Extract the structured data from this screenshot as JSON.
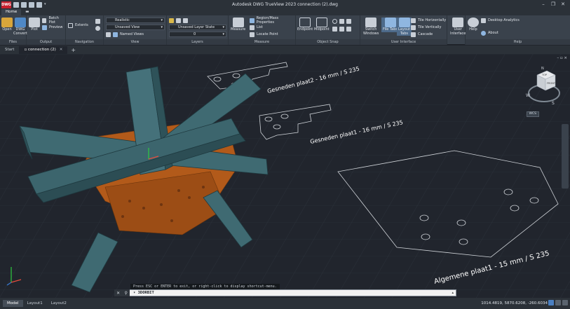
{
  "app": {
    "logo_text": "DWG",
    "title": "Autodesk DWG TrueView 2023   connection (2).dwg",
    "window_controls": [
      "–",
      "❐",
      "✕"
    ]
  },
  "ribbon_tabs": [
    {
      "label": "Home",
      "active": true
    },
    {
      "label": "▬",
      "active": false
    }
  ],
  "ribbon": {
    "files": {
      "label": "Files",
      "open": "Open",
      "dwg_convert": "DWG\nConvert"
    },
    "output": {
      "label": "Output",
      "plot": "Plot",
      "batch_plot": "Batch Plot",
      "preview": "Preview"
    },
    "navigation": {
      "label": "Navigation",
      "extents": "Extents"
    },
    "view": {
      "label": "View",
      "visual_style": "Realistic",
      "saved_view": "Unsaved View",
      "named_views": "Named Views"
    },
    "layers": {
      "label": "Layers",
      "layer_state": "Unsaved Layer State",
      "current_layer": "0"
    },
    "measure": {
      "label": "Measure",
      "measure": "Measure",
      "region_mass": "Region/Mass Properties",
      "list": "List",
      "locate_point": "Locate Point"
    },
    "object_snap": {
      "label": "Object Snap",
      "endpoint": "Endpoint",
      "midpoint": "Midpoint"
    },
    "user_interface": {
      "label": "User Interface",
      "switch_windows": "Switch\nWindows",
      "file_tabs": "File Tabs",
      "layout_tabs": "Layout\nTabs",
      "tile_h": "Tile Horizontally",
      "tile_v": "Tile Vertically",
      "cascade": "Cascade"
    },
    "help": {
      "label": "Help",
      "user_interface": "User\nInterface",
      "help": "Help",
      "desktop_analytics": "Desktop Analytics",
      "about": "About"
    }
  },
  "file_tabs": [
    {
      "label": "Start",
      "active": false,
      "closable": false
    },
    {
      "label": "connection (2)",
      "active": true,
      "closable": true
    }
  ],
  "viewport": {
    "controls": "– ▫ ×",
    "wcs": "WCS",
    "viewcube": {
      "top": "TOP",
      "front": "FRONT",
      "n": "N",
      "w": "W",
      "s": "S"
    }
  },
  "drawing_labels": [
    {
      "text": "Gesneden plaat2 - 16 mm / S 235"
    },
    {
      "text": "Gesneden plaat1 - 16 mm / S 235"
    },
    {
      "text": "Algemene plaat1 - 15 mm / S 235"
    }
  ],
  "command": {
    "history": "Press ESC or ENTER to exit, or right-click to display shortcut-menu.",
    "prompt": "3DORBIT",
    "prompt_prefix": "▾"
  },
  "status": {
    "layout_tabs": [
      {
        "label": "Model",
        "active": true
      },
      {
        "label": "Layout1",
        "active": false
      },
      {
        "label": "Layout2",
        "active": false
      }
    ],
    "coords": "1014.4819, 5870.6208, -260.6034"
  },
  "colors": {
    "tube": "#3f6a72",
    "plate": "#b25a1a",
    "background": "#21252d"
  }
}
